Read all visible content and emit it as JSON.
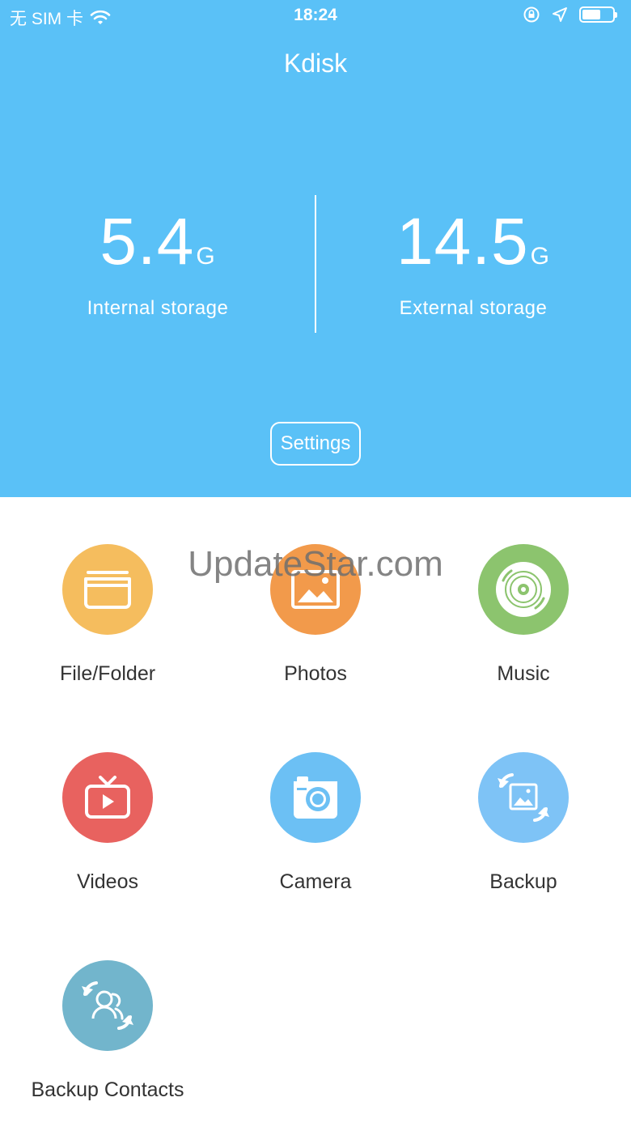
{
  "status_bar": {
    "carrier": "无 SIM 卡",
    "time": "18:24"
  },
  "app": {
    "title": "Kdisk"
  },
  "storage": {
    "internal": {
      "value": "5.4",
      "unit": "G",
      "label": "Internal storage"
    },
    "external": {
      "value": "14.5",
      "unit": "G",
      "label": "External storage"
    }
  },
  "settings_label": "Settings",
  "tiles": [
    {
      "label": "File/Folder",
      "icon": "folder-icon",
      "color": "#f5bd5e"
    },
    {
      "label": "Photos",
      "icon": "photo-icon",
      "color": "#f29a4b"
    },
    {
      "label": "Music",
      "icon": "disc-icon",
      "color": "#8cc46e"
    },
    {
      "label": "Videos",
      "icon": "tv-play-icon",
      "color": "#e8625f"
    },
    {
      "label": "Camera",
      "icon": "camera-icon",
      "color": "#6cc0f4"
    },
    {
      "label": "Backup",
      "icon": "photo-backup-icon",
      "color": "#7ec3f6"
    },
    {
      "label": "Backup Contacts",
      "icon": "contacts-backup-icon",
      "color": "#72b5cc"
    }
  ],
  "watermark": "UpdateStar.com",
  "colors": {
    "header": "#5ac1f7",
    "text": "#333333"
  }
}
